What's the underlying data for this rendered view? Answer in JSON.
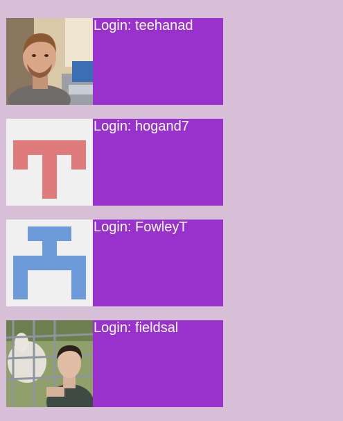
{
  "login_prefix": "Login: ",
  "colors": {
    "page_background": "#d8bfd8",
    "card_background": "#9932cc",
    "card_text": "#ffffff"
  },
  "users": [
    {
      "login": "teehanad",
      "label": "Login: teehanad",
      "avatar": "photo"
    },
    {
      "login": "hogand7",
      "label": "Login: hogand7",
      "avatar": "identicon",
      "avatar_color": "#e07b7b"
    },
    {
      "login": "FowleyT",
      "label": "Login: FowleyT",
      "avatar": "identicon",
      "avatar_color": "#6d9bd9"
    },
    {
      "login": "fieldsal",
      "label": "Login: fieldsal",
      "avatar": "photo"
    }
  ]
}
